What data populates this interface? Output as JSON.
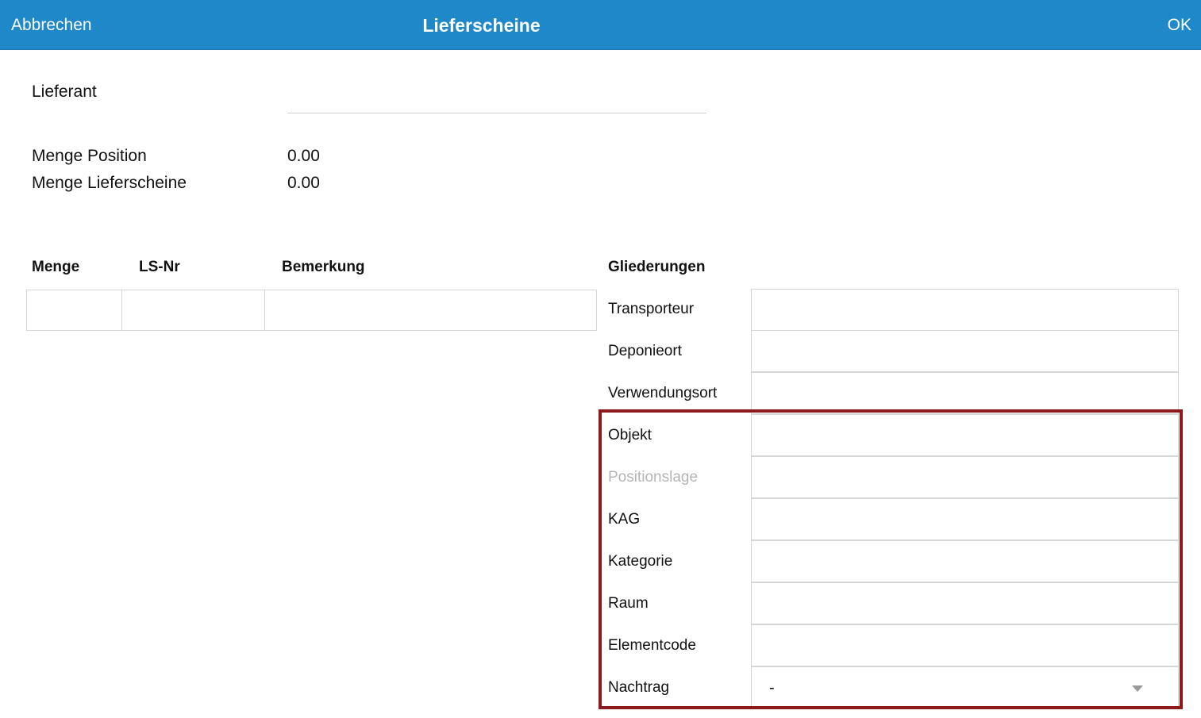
{
  "navbar": {
    "cancel_label": "Abbrechen",
    "title": "Lieferscheine",
    "ok_label": "OK",
    "color": "#1e88c9"
  },
  "form": {
    "supplier_label": "Lieferant",
    "supplier_value": "",
    "qty_position_label": "Menge Position",
    "qty_position_value": "0.00",
    "qty_delivery_label": "Menge Lieferscheine",
    "qty_delivery_value": "0.00"
  },
  "table": {
    "headers": [
      "Menge",
      "LS-Nr",
      "Bemerkung"
    ],
    "rows": [
      [
        "",
        "",
        ""
      ]
    ]
  },
  "gliederungen": {
    "heading": "Gliederungen",
    "fields": [
      {
        "label": "Transporteur",
        "value": ""
      },
      {
        "label": "Deponieort",
        "value": ""
      },
      {
        "label": "Verwendungsort",
        "value": ""
      },
      {
        "label": "Objekt",
        "value": ""
      },
      {
        "label": "Positionslage",
        "value": "",
        "disabled": true
      },
      {
        "label": "KAG",
        "value": ""
      },
      {
        "label": "Kategorie",
        "value": ""
      },
      {
        "label": "Raum",
        "value": ""
      },
      {
        "label": "Elementcode",
        "value": ""
      },
      {
        "label": "Nachtrag",
        "value": "-",
        "type": "select",
        "icon": "chevron-down-icon"
      }
    ]
  },
  "highlight_color": "#8b1a1a"
}
